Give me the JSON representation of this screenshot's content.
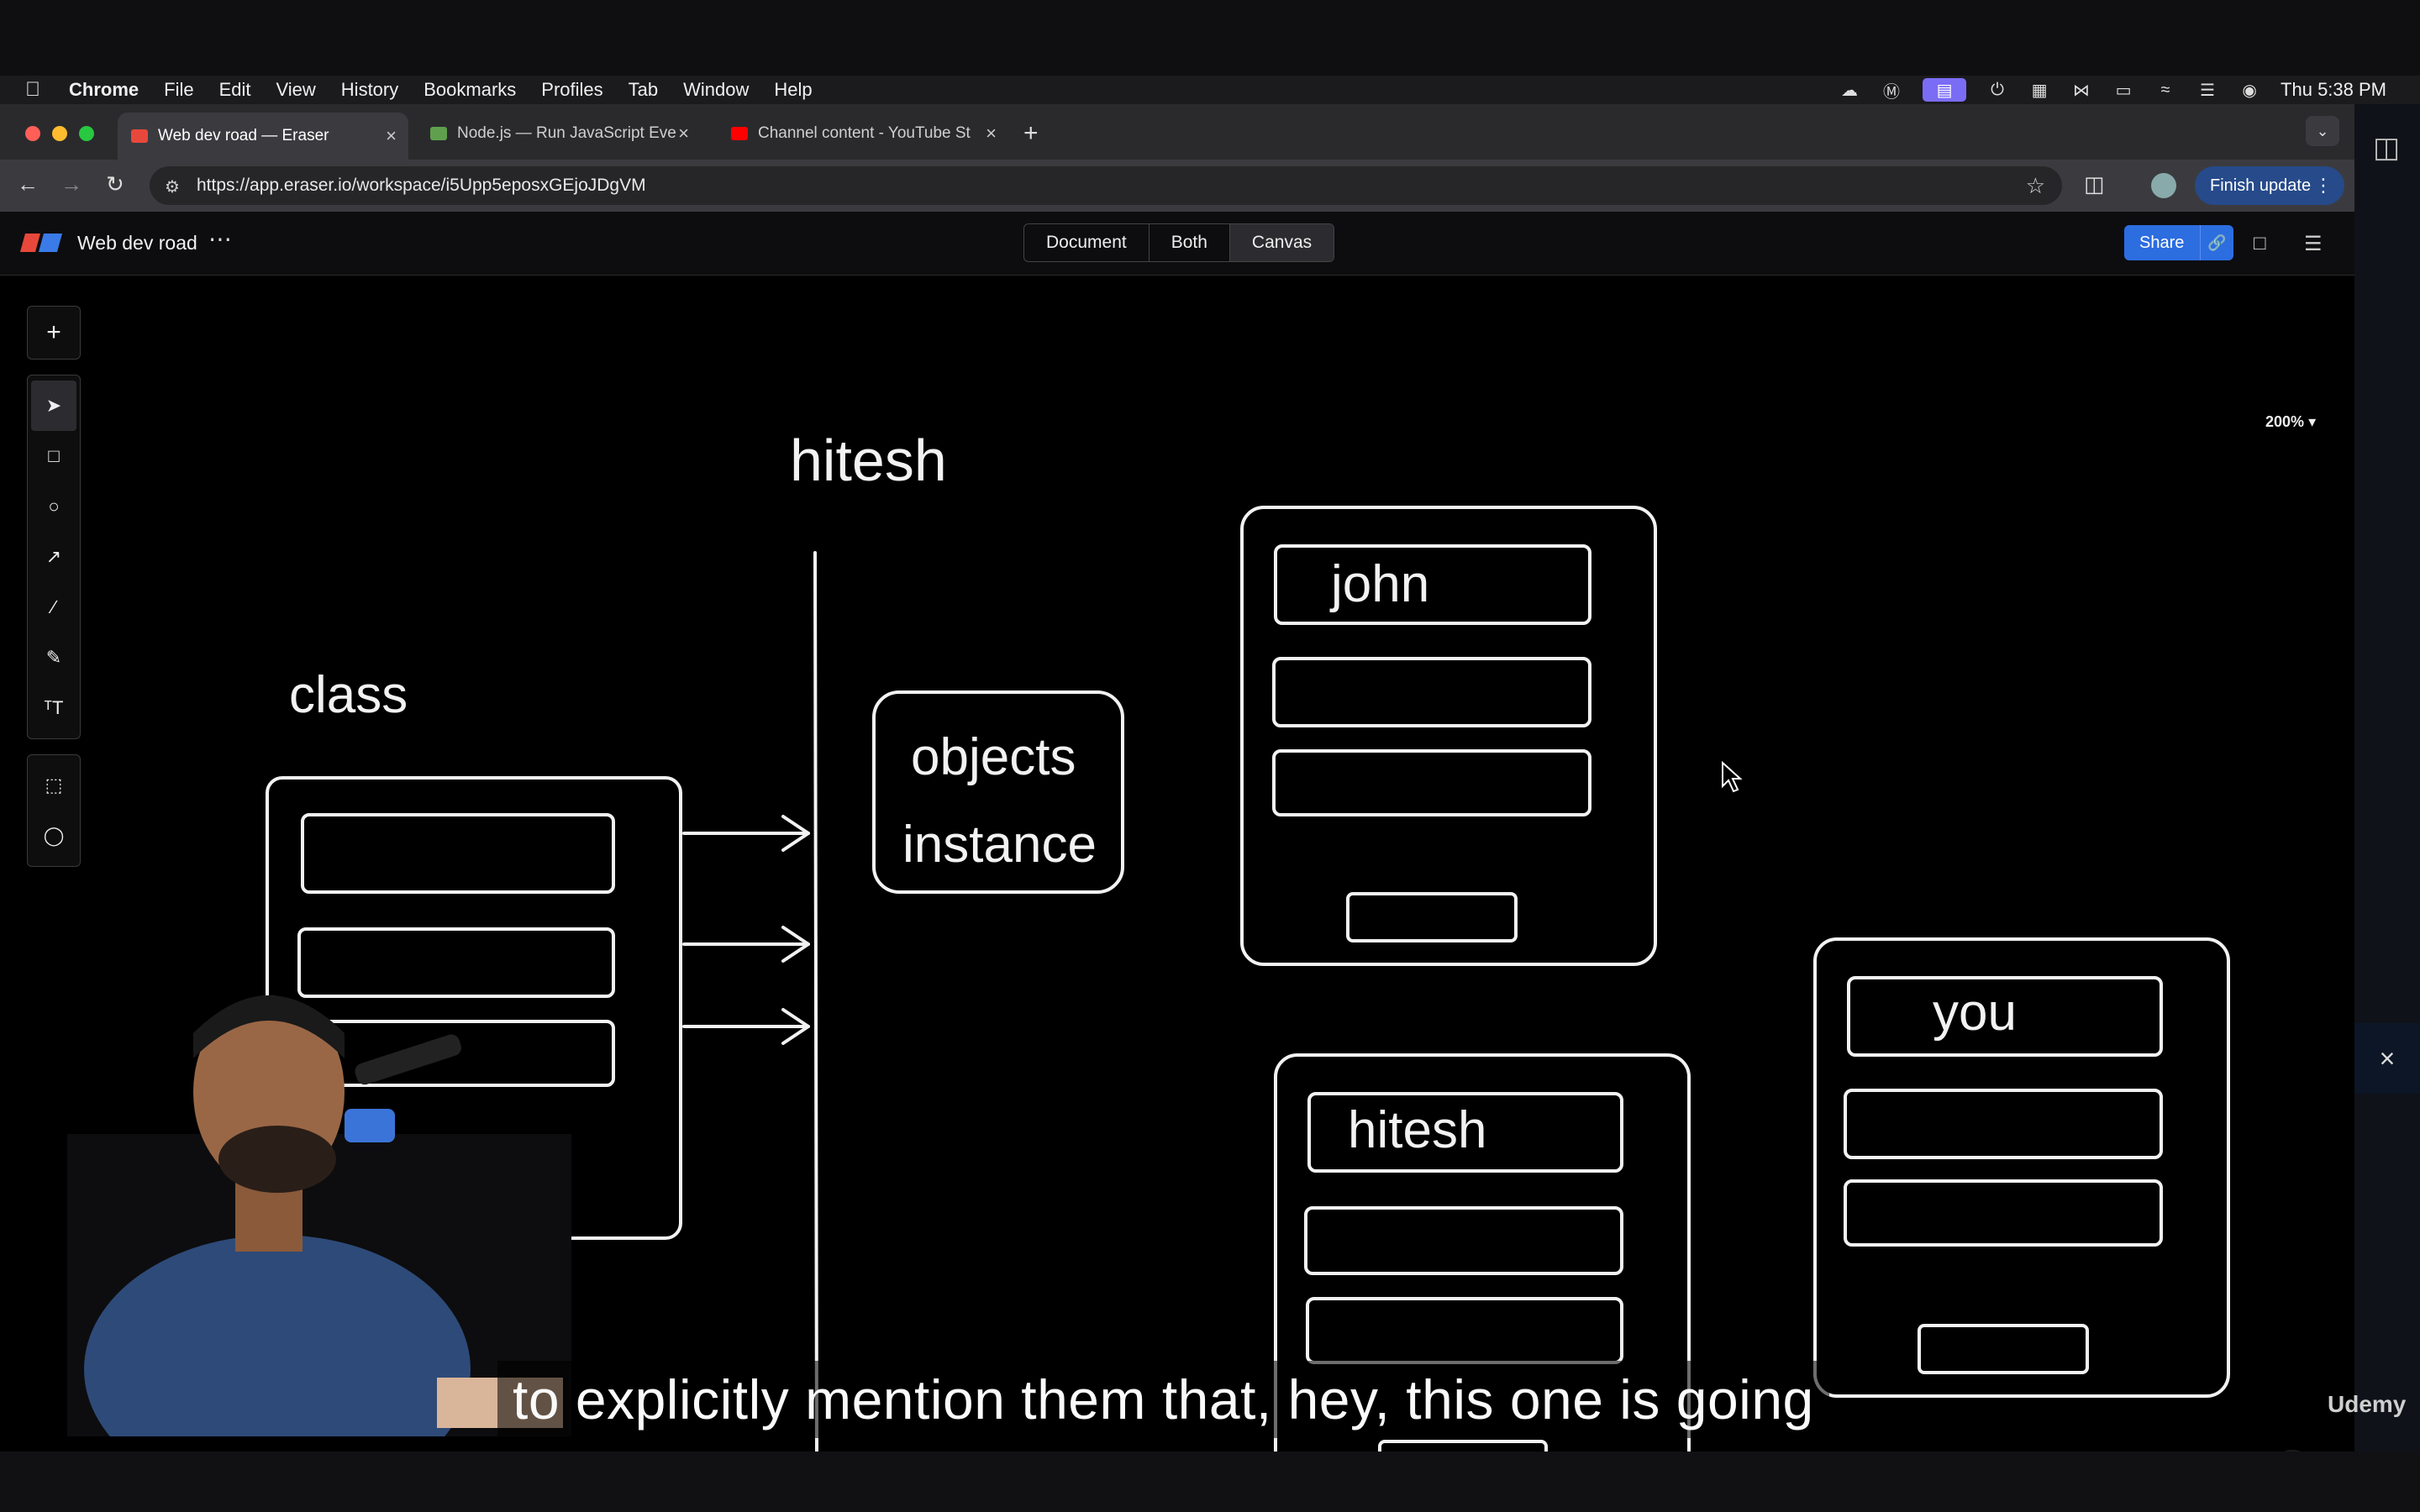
{
  "menubar": {
    "app": "Chrome",
    "items": [
      "File",
      "Edit",
      "View",
      "History",
      "Bookmarks",
      "Profiles",
      "Tab",
      "Window",
      "Help"
    ],
    "clock": "Thu 5:38 PM"
  },
  "tabs": [
    {
      "title": "Web dev road — Eraser",
      "favicon_color": "#e8483b"
    },
    {
      "title": "Node.js — Run JavaScript Eve",
      "favicon_color": "#5fa04e"
    },
    {
      "title": "Channel content - YouTube St",
      "favicon_color": "#ff0000"
    }
  ],
  "address": {
    "url": "https://app.eraser.io/workspace/i5Upp5eposxGEjoJDgVM",
    "finish_update": "Finish update"
  },
  "app": {
    "doc_title": "Web dev road",
    "views": [
      "Document",
      "Both",
      "Canvas"
    ],
    "active_view": "Canvas",
    "share_label": "Share",
    "zoom_label": "200%"
  },
  "toolbar": {
    "tools": [
      "select",
      "rectangle",
      "ellipse",
      "arrow",
      "line",
      "pencil",
      "text",
      "frame",
      "comment"
    ]
  },
  "canvas_text": {
    "heading": "hitesh",
    "class_label": "class",
    "objects_label": "objects",
    "instance_label": "instance",
    "card1_name": "john",
    "card2_name": "hitesh",
    "card3_name": "you"
  },
  "help_label": "?",
  "watermark": "Udemy",
  "caption": "to explicitly mention them that, hey, this one is going",
  "colors": {
    "canvas_bg": "#000000",
    "stroke": "#f2f2f2",
    "share_blue": "#2c6de0",
    "finish_update_bg": "#264a8a"
  }
}
